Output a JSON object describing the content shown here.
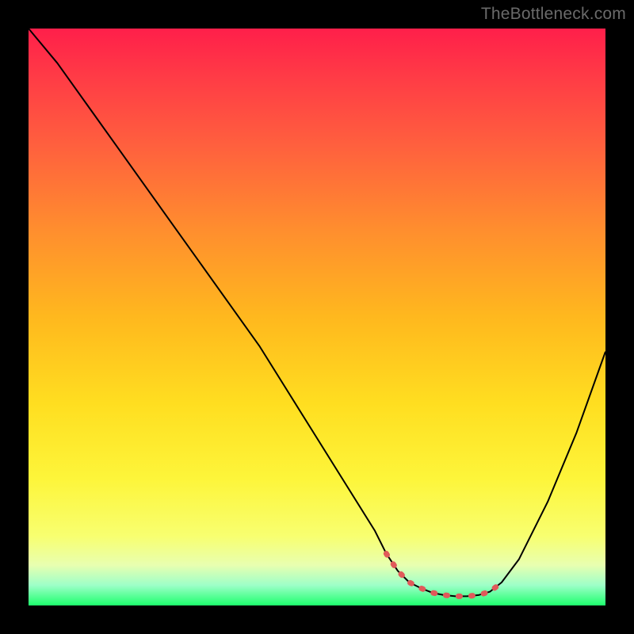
{
  "watermark": "TheBottleneck.com",
  "chart_data": {
    "type": "line",
    "title": "",
    "xlabel": "",
    "ylabel": "",
    "xlim": [
      0,
      100
    ],
    "ylim": [
      0,
      100
    ],
    "grid": false,
    "legend": false,
    "series": [
      {
        "name": "curve-black",
        "color": "#000000",
        "x": [
          0,
          5,
          10,
          15,
          20,
          25,
          30,
          35,
          40,
          45,
          50,
          55,
          60,
          62,
          64,
          66,
          68,
          70,
          72,
          74,
          76,
          78,
          80,
          82,
          85,
          90,
          95,
          100
        ],
        "y": [
          100,
          94,
          87,
          80,
          73,
          66,
          59,
          52,
          45,
          37,
          29,
          21,
          13,
          9,
          6,
          4,
          3,
          2.2,
          1.8,
          1.6,
          1.6,
          1.8,
          2.4,
          4,
          8,
          18,
          30,
          44
        ]
      },
      {
        "name": "valley-highlight",
        "color": "#e05a5a",
        "x": [
          62,
          64,
          66,
          68,
          70,
          72,
          74,
          76,
          78,
          80,
          82
        ],
        "y": [
          9,
          6,
          4,
          3,
          2.2,
          1.8,
          1.6,
          1.6,
          1.8,
          2.4,
          4
        ]
      }
    ],
    "gradient_stops": [
      {
        "pos": 0,
        "color": "#ff1f4a"
      },
      {
        "pos": 0.35,
        "color": "#ff8e2e"
      },
      {
        "pos": 0.65,
        "color": "#ffde20"
      },
      {
        "pos": 0.88,
        "color": "#f8ff70"
      },
      {
        "pos": 1.0,
        "color": "#1eff6d"
      }
    ]
  }
}
